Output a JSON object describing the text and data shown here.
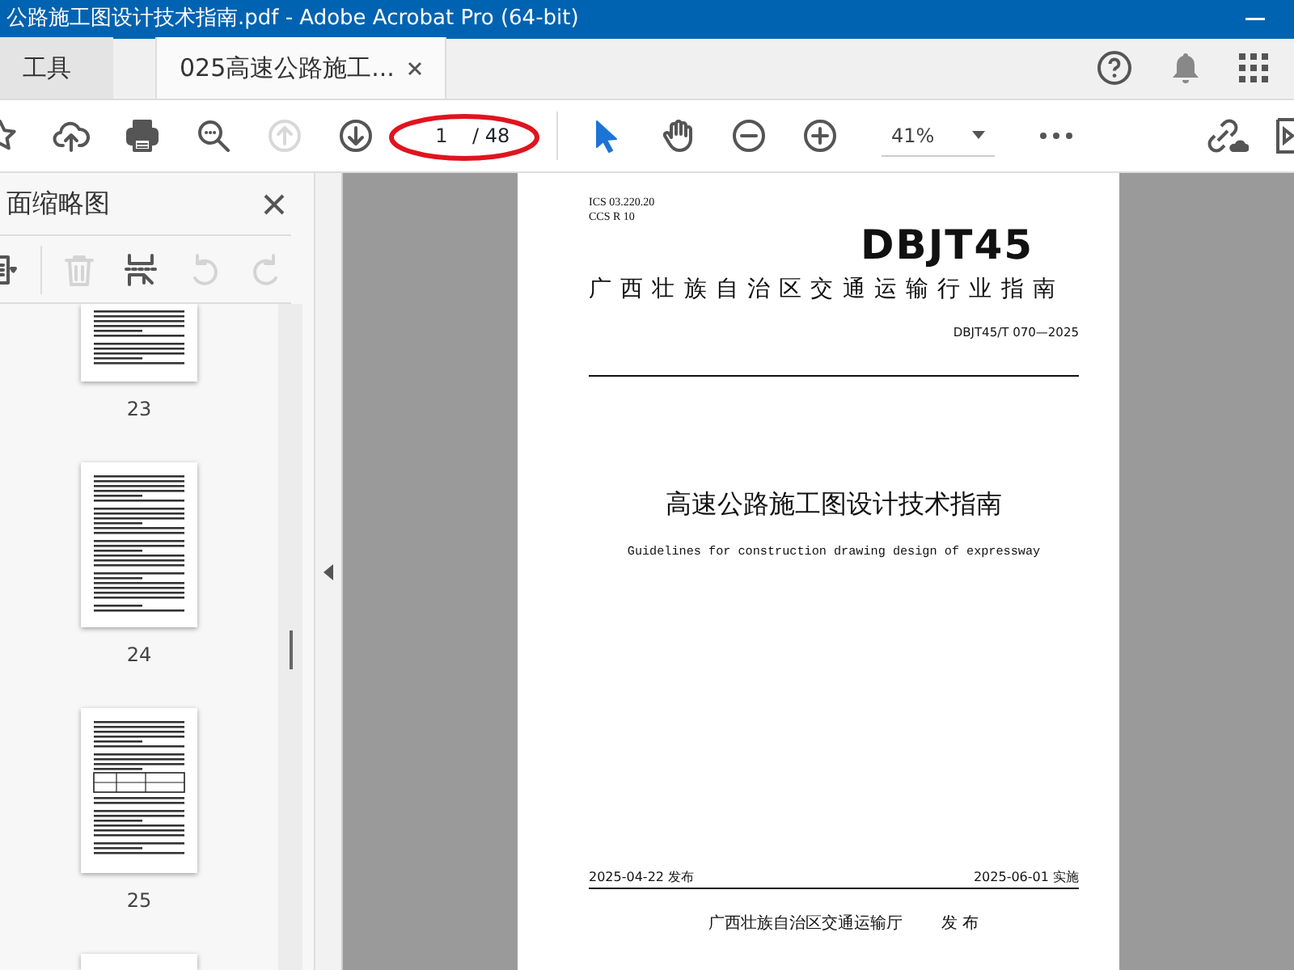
{
  "window": {
    "title": "公路施工图设计技术指南.pdf - Adobe Acrobat Pro (64-bit)"
  },
  "tabs": [
    {
      "label": "工具",
      "selected": false
    },
    {
      "label": "025高速公路施工...",
      "selected": true
    }
  ],
  "toolbar": {
    "buttons": [
      {
        "kind": "star",
        "disabled": false
      },
      {
        "kind": "upload",
        "disabled": false
      },
      {
        "kind": "print",
        "disabled": false
      },
      {
        "kind": "zoom-search",
        "disabled": false
      },
      {
        "kind": "prev-page",
        "disabled": true
      },
      {
        "kind": "next-page",
        "disabled": false
      },
      {
        "kind": "page",
        "disabled": false
      },
      {
        "kind": "select",
        "disabled": false
      },
      {
        "kind": "hand",
        "disabled": false
      },
      {
        "kind": "zoom-out",
        "disabled": false
      },
      {
        "kind": "zoom-in",
        "disabled": false
      },
      {
        "kind": "zoom-level",
        "disabled": false
      },
      {
        "kind": "more",
        "disabled": false
      }
    ],
    "page_number": "1",
    "page_count": "/ 48",
    "zoom": "41%"
  },
  "thumbnail_panel": {
    "title": "面缩略图",
    "tools": [
      {
        "kind": "options",
        "disabled": false
      },
      {
        "kind": "delete",
        "disabled": true
      },
      {
        "kind": "insert",
        "disabled": false
      },
      {
        "kind": "undo",
        "disabled": true
      },
      {
        "kind": "redo",
        "disabled": true
      }
    ],
    "thumbnails": [
      {
        "page": "23",
        "cut_top": true,
        "kind": "text"
      },
      {
        "page": "24",
        "cut_top": false,
        "kind": "text"
      },
      {
        "page": "25",
        "cut_top": false,
        "kind": "table"
      }
    ]
  },
  "document": {
    "ics": "ICS 03.220.20",
    "ccs": "CCS R 10",
    "code": "DBJT45",
    "category": "广西壮族自治区交通运输行业指南",
    "number": "DBJT45/T 070—2025",
    "title": "高速公路施工图设计技术指南",
    "subtitle": "Guidelines for construction drawing design of expressway",
    "issue_date": "2025-04-22 发布",
    "effective_date": "2025-06-01 实施",
    "issuer": "广西壮族自治区交通运输厅",
    "issuer_action": "发 布"
  }
}
